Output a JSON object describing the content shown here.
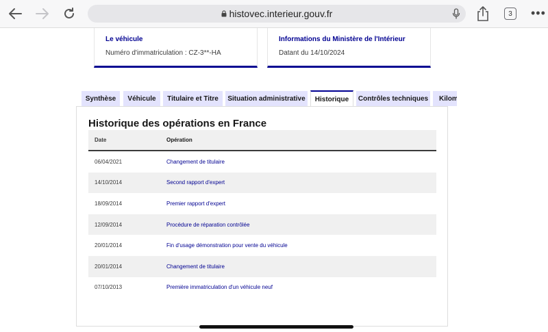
{
  "browser": {
    "url": "histovec.interieur.gouv.fr",
    "tabs_count": "3",
    "icons": [
      "back-arrow-icon",
      "forward-arrow-icon",
      "reload-icon",
      "lock-icon",
      "microphone-icon",
      "share-icon",
      "tabs-icon",
      "more-icon"
    ]
  },
  "cards": [
    {
      "title": "Le véhicule",
      "subtitle": "Numéro d'immatriculation : CZ-3**-HA"
    },
    {
      "title": "Informations du Ministère de l'Intérieur",
      "subtitle": "Datant du 14/10/2024"
    }
  ],
  "tabs": [
    {
      "label": "Synthèse"
    },
    {
      "label": "Véhicule"
    },
    {
      "label": "Titulaire et Titre"
    },
    {
      "label": "Situation administrative"
    },
    {
      "label": "Historique",
      "active": true
    },
    {
      "label": "Contrôles techniques"
    },
    {
      "label": "Kilométrage"
    }
  ],
  "history": {
    "title": "Historique des opérations en France",
    "columns": {
      "date": "Date",
      "operation": "Opération"
    },
    "rows": [
      {
        "date": "06/04/2021",
        "operation": "Changement de titulaire"
      },
      {
        "date": "14/10/2014",
        "operation": "Second rapport d'expert"
      },
      {
        "date": "18/09/2014",
        "operation": "Premier rapport d'expert"
      },
      {
        "date": "12/09/2014",
        "operation": "Procédure de réparation contrôlée"
      },
      {
        "date": "20/01/2014",
        "operation": "Fin d'usage démonstration pour vente du véhicule"
      },
      {
        "date": "20/01/2014",
        "operation": "Changement de titulaire"
      },
      {
        "date": "07/10/2013",
        "operation": "Première immatriculation d'un véhicule neuf"
      }
    ]
  },
  "colors": {
    "accent": "#000091",
    "tab_bg": "#e3e3fd",
    "row_alt": "#f0f0f0"
  }
}
